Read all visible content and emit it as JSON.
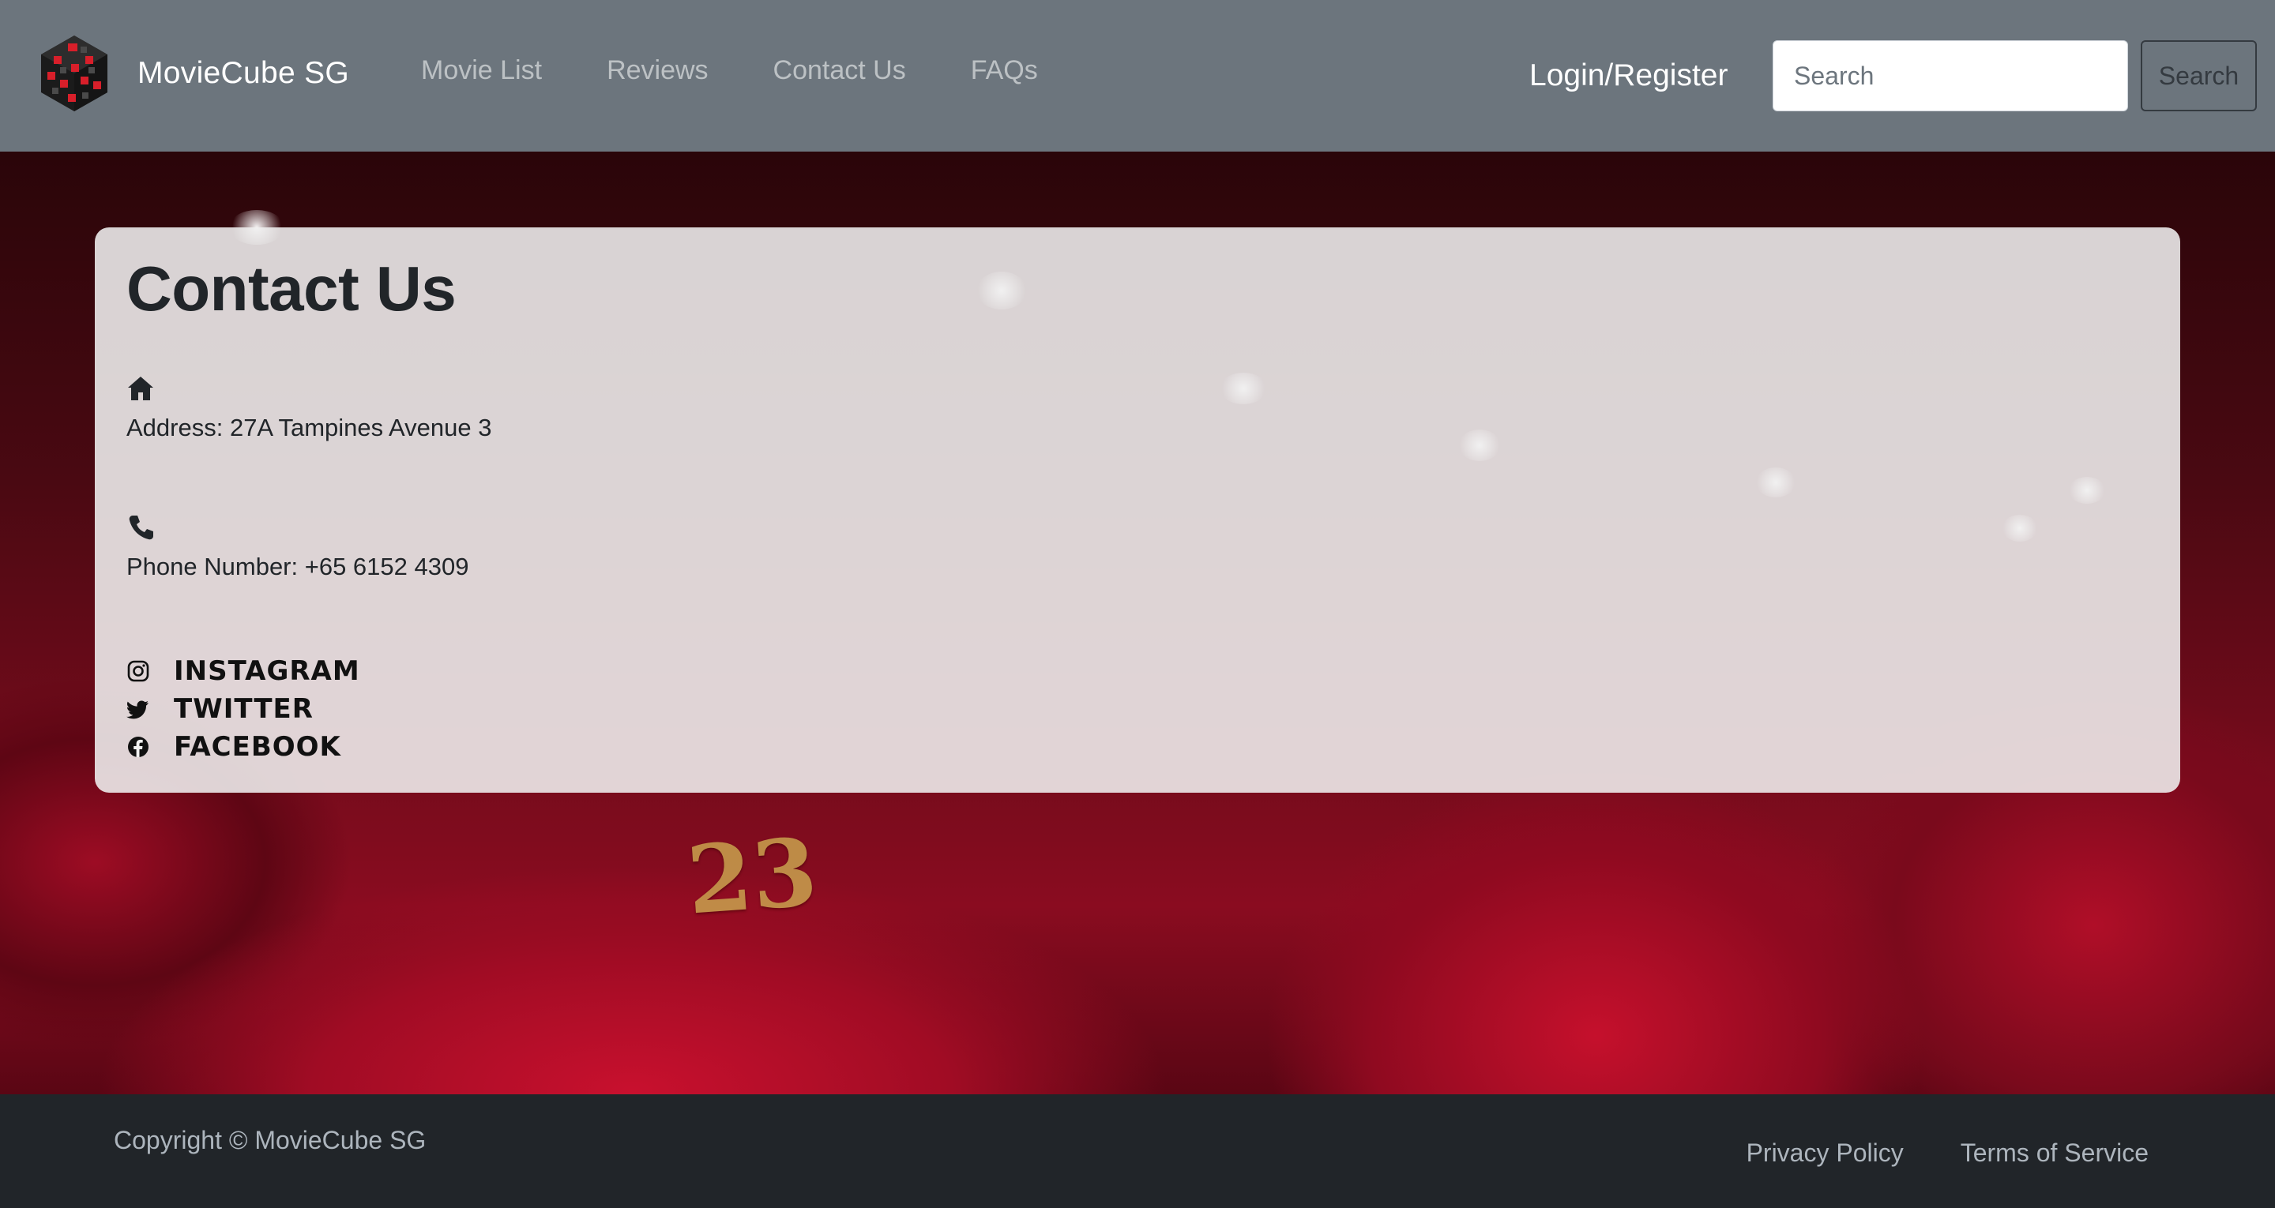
{
  "navbar": {
    "brand_name": "MovieCube SG",
    "logo_icon": "cube-logo-icon",
    "links": [
      {
        "label": "Movie List"
      },
      {
        "label": "Reviews"
      },
      {
        "label": "Contact Us"
      },
      {
        "label": "FAQs"
      }
    ],
    "login_label": "Login/Register",
    "search": {
      "placeholder": "Search",
      "value": ""
    },
    "search_button_label": "Search",
    "colors": {
      "background": "#6c757d",
      "link": "rgba(255,255,255,0.55)"
    }
  },
  "hero": {
    "seat_number": "23"
  },
  "contact": {
    "title": "Contact Us",
    "address": {
      "icon": "home-icon",
      "text": "Address: 27A Tampines Avenue 3"
    },
    "phone": {
      "icon": "phone-icon",
      "text": "Phone Number: +65 6152 4309"
    },
    "socials": [
      {
        "icon": "instagram-icon",
        "label": "INSTAGRAM"
      },
      {
        "icon": "twitter-icon",
        "label": "TWITTER"
      },
      {
        "icon": "facebook-icon",
        "label": "FACEBOOK"
      }
    ]
  },
  "footer": {
    "copyright": "Copyright © MovieCube SG",
    "links": [
      {
        "label": "Privacy Policy"
      },
      {
        "label": "Terms of Service"
      }
    ],
    "colors": {
      "background": "#212529",
      "text": "#adb5bd"
    }
  }
}
